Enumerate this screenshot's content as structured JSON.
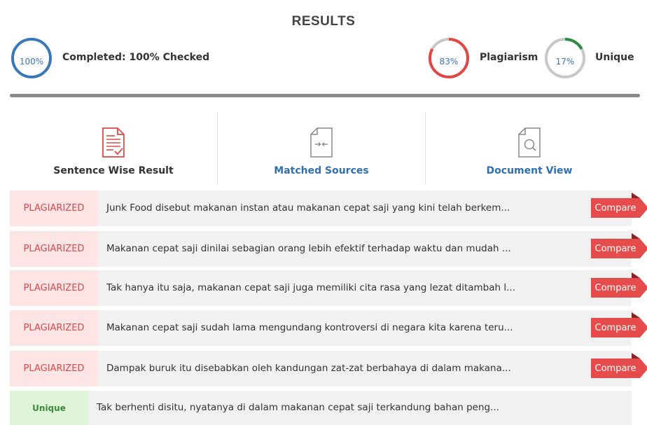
{
  "header": {
    "title": "RESULTS"
  },
  "completed": {
    "percent_label": "100%",
    "label": "Completed: 100% Checked",
    "fraction": 1.0,
    "color": "#3b78b8"
  },
  "plagiarism": {
    "percent_label": "83%",
    "label": "Plagiarism",
    "fraction": 0.83,
    "color": "#e04848"
  },
  "unique": {
    "percent_label": "17%",
    "label": "Unique",
    "fraction": 0.17,
    "color": "#2e8b3e"
  },
  "tabs": [
    {
      "label": "Sentence Wise Result",
      "icon": "document-check-icon",
      "color": "#333333"
    },
    {
      "label": "Matched Sources",
      "icon": "compare-arrows-file-icon",
      "color": "#2f6fb0"
    },
    {
      "label": "Document View",
      "icon": "document-search-icon",
      "color": "#2f6fb0"
    }
  ],
  "rows": [
    {
      "tag": "PLAGIARIZED",
      "text": "Junk Food disebut makanan instan atau makanan cepat saji yang kini telah berkem...",
      "action": "Compare"
    },
    {
      "tag": "PLAGIARIZED",
      "text": "Makanan cepat saji dinilai sebagian orang lebih efektif terhadap waktu dan mudah ...",
      "action": "Compare"
    },
    {
      "tag": "PLAGIARIZED",
      "text": "Tak hanya itu saja, makanan cepat saji juga memiliki cita rasa yang lezat ditambah l...",
      "action": "Compare"
    },
    {
      "tag": "PLAGIARIZED",
      "text": "Makanan cepat saji sudah lama mengundang kontroversi di negara kita karena teru...",
      "action": "Compare"
    },
    {
      "tag": "PLAGIARIZED",
      "text": "Dampak buruk itu disebabkan oleh kandungan zat-zat berbahaya di dalam makana...",
      "action": "Compare"
    },
    {
      "tag": "Unique",
      "text": "Tak berhenti disitu, nyatanya di dalam makanan cepat saji terkandung bahan peng..."
    }
  ]
}
